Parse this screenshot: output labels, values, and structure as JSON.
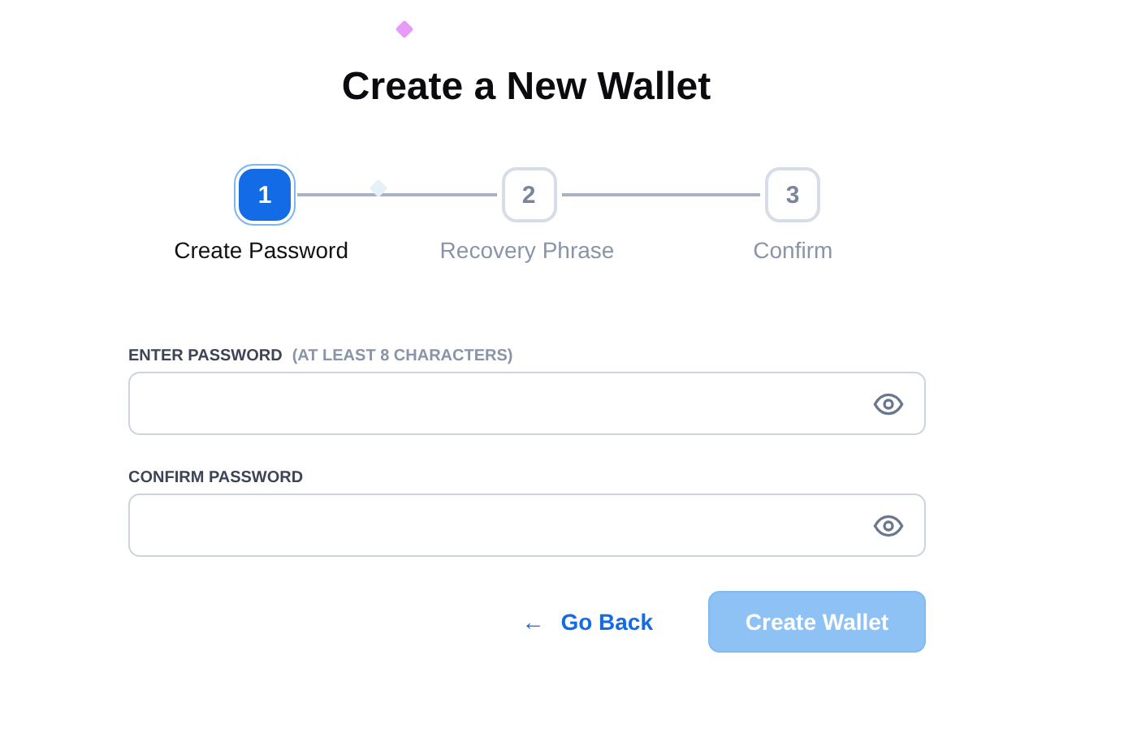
{
  "title": "Create a New Wallet",
  "steps": [
    {
      "number": "1",
      "label": "Create Password",
      "selected": true
    },
    {
      "number": "2",
      "label": "Recovery Phrase",
      "selected": false
    },
    {
      "number": "3",
      "label": "Confirm",
      "selected": false
    }
  ],
  "fields": [
    {
      "label": "ENTER PASSWORD",
      "hint": "(AT LEAST 8 CHARACTERS)"
    },
    {
      "label": "CONFIRM PASSWORD"
    }
  ],
  "back_button": {
    "icon": "←",
    "label": "Go Back"
  },
  "submit_button": {
    "label": "Create Wallet",
    "disabled": true
  }
}
